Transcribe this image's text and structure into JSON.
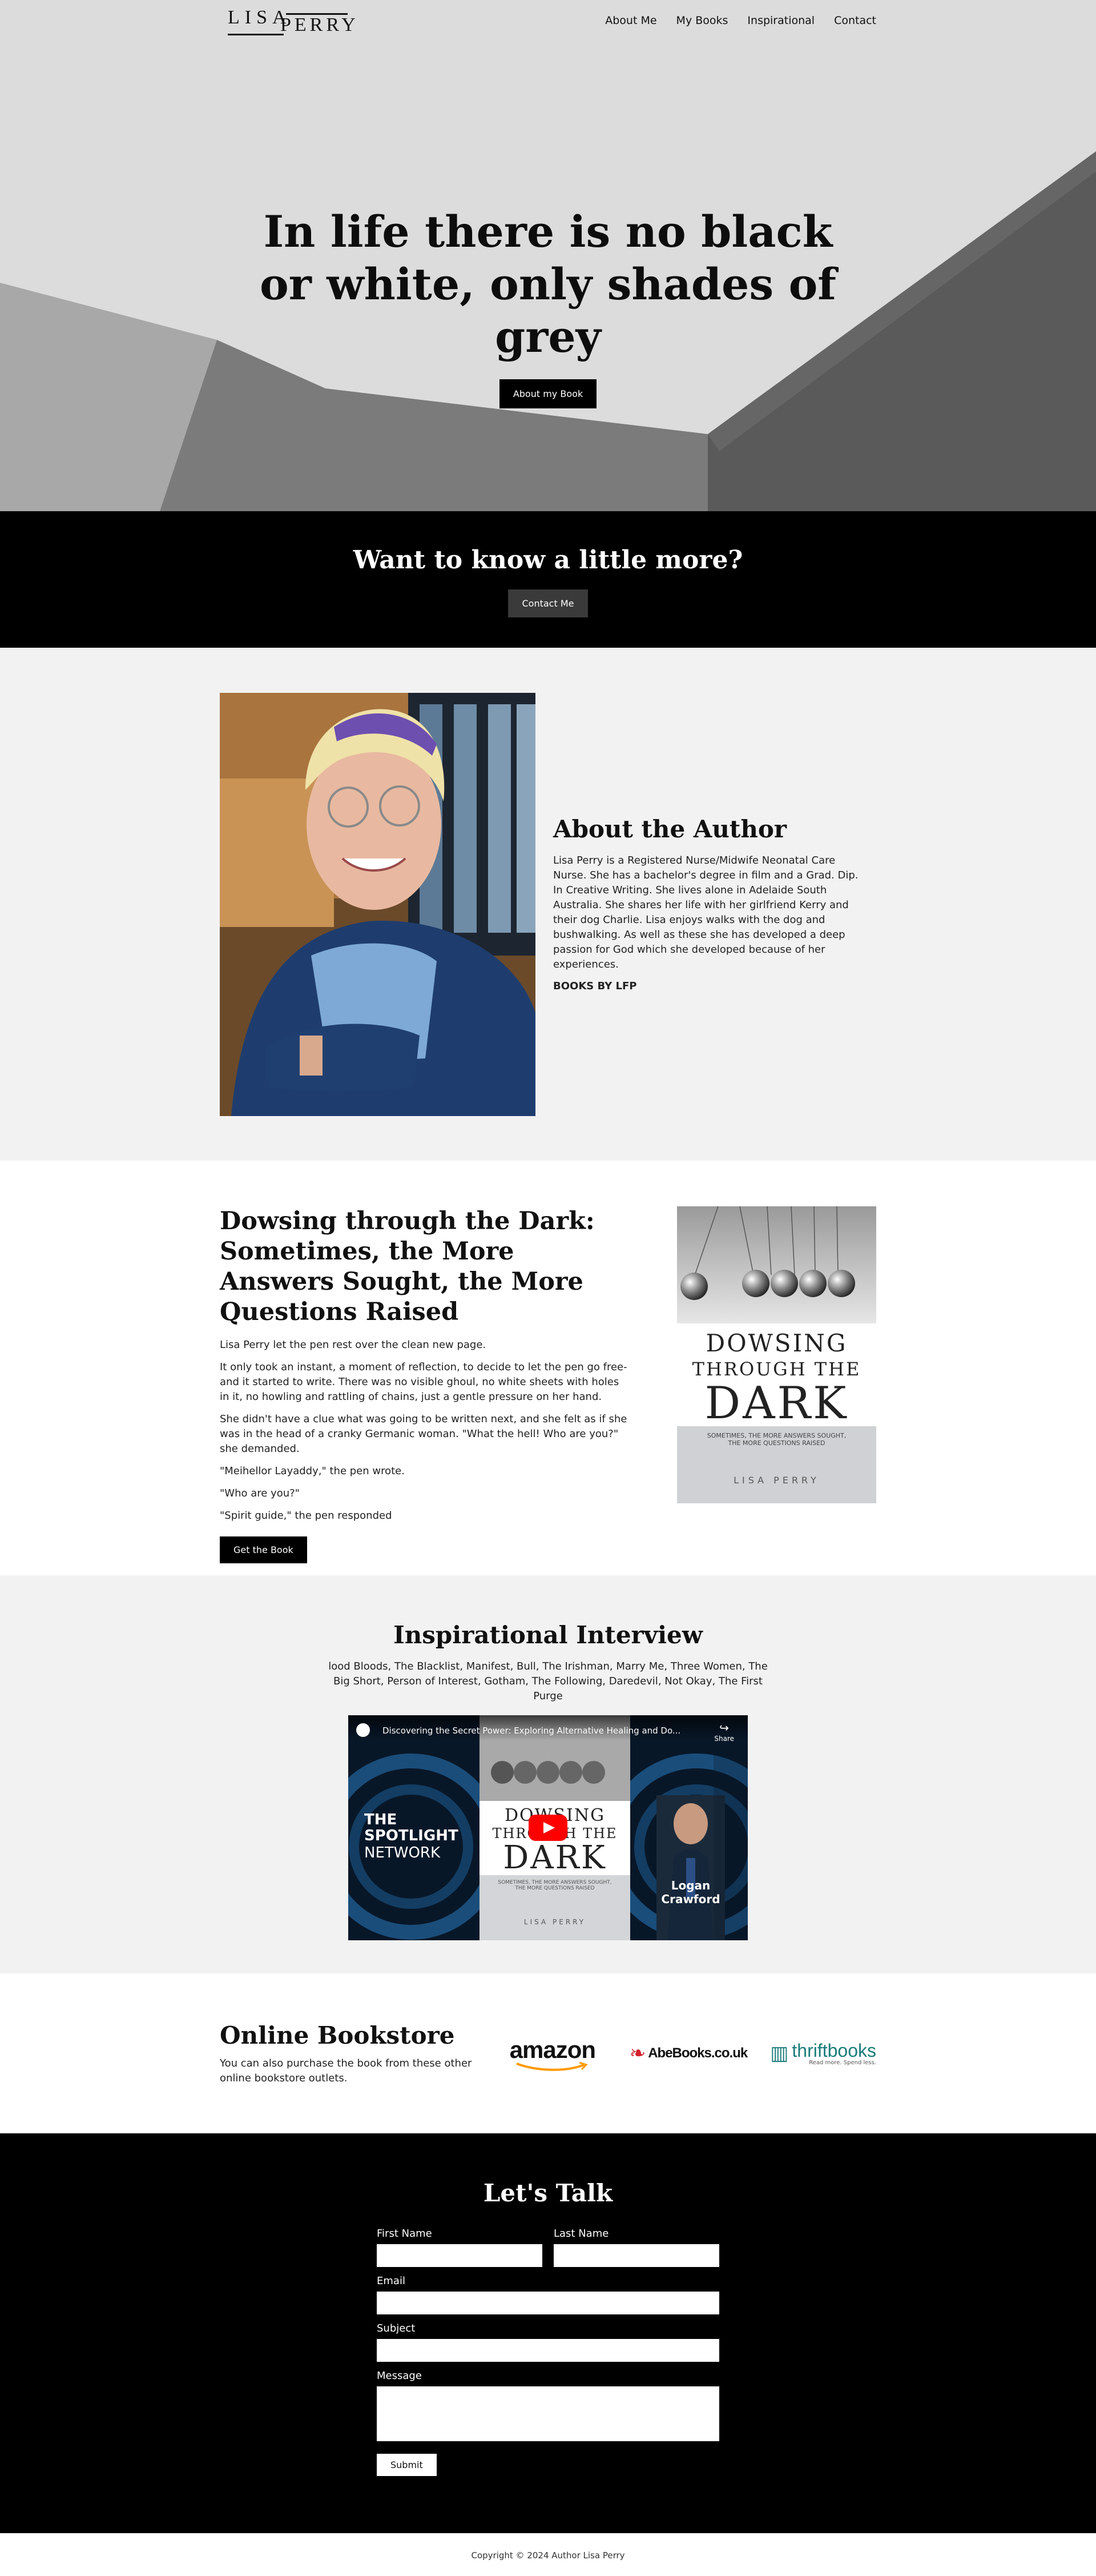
{
  "nav": {
    "logo_top": "LISA",
    "logo_bottom": "PERRY",
    "items": [
      "About Me",
      "My Books",
      "Inspirational",
      "Contact"
    ]
  },
  "hero": {
    "title": "In life there is no black or white, only shades of grey",
    "button": "About my Book"
  },
  "cta": {
    "title": "Want to know a little more?",
    "button": "Contact Me"
  },
  "about": {
    "title": "About the Author",
    "body": "Lisa Perry is a Registered Nurse/Midwife Neonatal Care Nurse. She has a bachelor's degree in film and a Grad. Dip. In Creative Writing. She lives alone in Adelaide South Australia. She shares her life with her girlfriend Kerry and their dog Charlie. Lisa enjoys walks with the dog and bushwalking. As well as these she has developed a deep passion for God which she developed because of her experiences.",
    "books_label": "BOOKS BY LFP"
  },
  "book": {
    "title": "Dowsing through the Dark: Sometimes, the More Answers Sought, the More Questions Raised",
    "paragraphs": [
      "Lisa Perry let the pen rest over the clean new page.",
      "It only took an instant, a moment of reflection, to decide to let the pen go free-and it started to write. There was no visible ghoul, no white sheets with holes in it, no howling and rattling of chains, just a gentle pressure on her hand.",
      "She didn't have a clue what was going to be written next, and she felt as if she was in the head of a cranky Germanic woman. \"What the hell! Who are you?\" she demanded.",
      "\"Meihellor Layaddy,\" the pen wrote.",
      "\"Who are you?\"",
      "\"Spirit guide,\" the pen responded"
    ],
    "button": "Get the Book",
    "cover": {
      "line1": "DOWSING",
      "line2": "THROUGH THE",
      "line3": "DARK",
      "subtitle1": "SOMETIMES, THE MORE ANSWERS SOUGHT,",
      "subtitle2": "THE MORE QUESTIONS RAISED",
      "author": "LISA PERRY"
    }
  },
  "interview": {
    "title": "Inspirational Interview",
    "shows": "lood Bloods, The Blacklist, Manifest, Bull, The Irishman, Marry Me, Three Women, The Big Short, Person of Interest, Gotham, The Following, Daredevil, Not Okay, The First Purge",
    "video_title": "Discovering the Secret Power: Exploring Alternative Healing and Do...",
    "share_label": "Share",
    "network_line1": "THE",
    "network_line2": "SPOTLIGHT",
    "network_line3": "NETWORK",
    "host_name": "Logan Crawford",
    "cover": {
      "line1": "DOWSING",
      "line2": "THROUGH THE",
      "line3": "DARK",
      "subtitle1": "SOMETIMES, THE MORE ANSWERS SOUGHT,",
      "subtitle2": "THE MORE QUESTIONS RAISED",
      "author": "LISA PERRY"
    }
  },
  "store": {
    "title": "Online Bookstore",
    "body": "You can also purchase the book from these other online bookstore outlets.",
    "amazon": "amazon",
    "abebooks": "AbeBooks.co.uk",
    "thriftbooks": "thriftbooks",
    "thrift_tagline": "Read more. Spend less."
  },
  "contact": {
    "title": "Let's Talk",
    "first_name": "First Name",
    "last_name": "Last Name",
    "email": "Email",
    "subject": "Subject",
    "message": "Message",
    "submit": "Submit"
  },
  "footer": {
    "copyright": "Copyright © 2024 Author Lisa Perry"
  },
  "colors": {
    "hero_bg": "#dcdcdc",
    "dark": "#000000",
    "section_grey": "#f2f2f2",
    "amazon_orange": "#ff9900",
    "abebooks_red": "#d4212b",
    "thrift_teal": "#1a7c7a",
    "youtube_red": "#ff0000"
  }
}
